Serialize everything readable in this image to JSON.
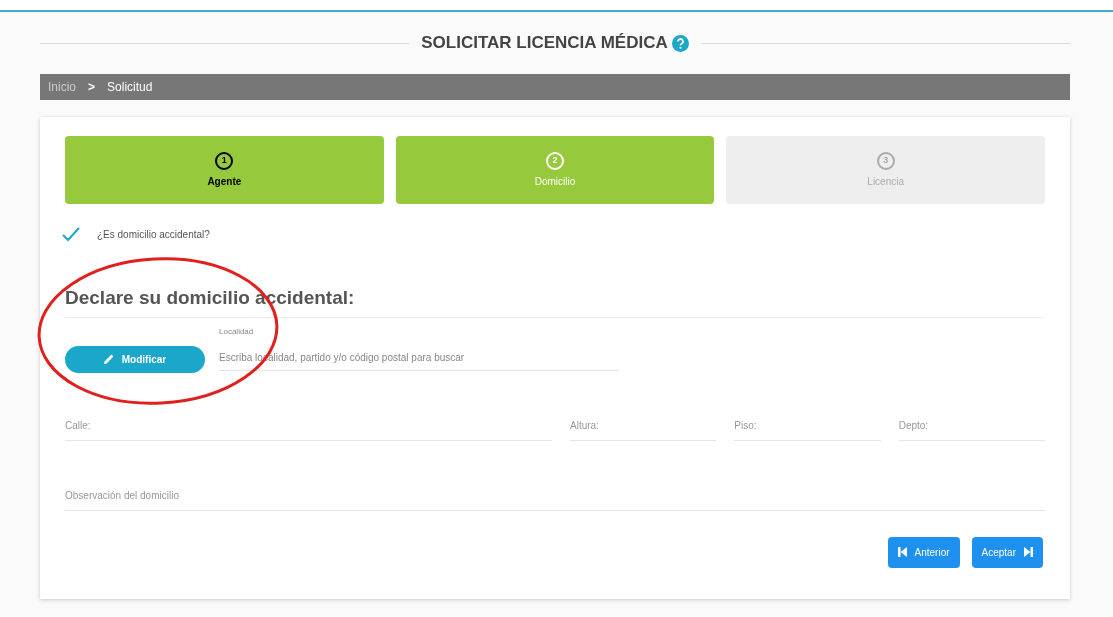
{
  "title": "SOLICITAR LICENCIA MÉDICA",
  "breadcrumb": [
    {
      "label": "Inicio",
      "selected": false
    },
    {
      "label": "Solicitud",
      "selected": true
    }
  ],
  "breadcrumb_separator": ">",
  "steps": [
    {
      "number": "1",
      "label": "Agente",
      "completed": true,
      "selected": false
    },
    {
      "number": "2",
      "label": "Domicilio",
      "completed": false,
      "selected": true
    },
    {
      "number": "3",
      "label": "Licencia",
      "completed": false,
      "selected": false
    }
  ],
  "accidental": {
    "label": "¿Es domicilio accidental?",
    "checked": true
  },
  "section_title": "Declare su domicilio accidental:",
  "modify_button": "Modificar",
  "locality": {
    "label": "Localidad",
    "placeholder": "Escriba localidad, partido y/o código postal para buscar"
  },
  "address_fields": [
    {
      "placeholder": "Calle:"
    },
    {
      "placeholder": "Altura:"
    },
    {
      "placeholder": "Piso:"
    },
    {
      "placeholder": "Depto:"
    }
  ],
  "observation": {
    "placeholder": "Observación del domicilio"
  },
  "buttons": [
    {
      "label": "Anterior",
      "kind": "back"
    },
    {
      "label": "Aceptar",
      "kind": "next"
    }
  ],
  "annotation": {
    "kind": "ellipse",
    "color": "#e0201c"
  }
}
